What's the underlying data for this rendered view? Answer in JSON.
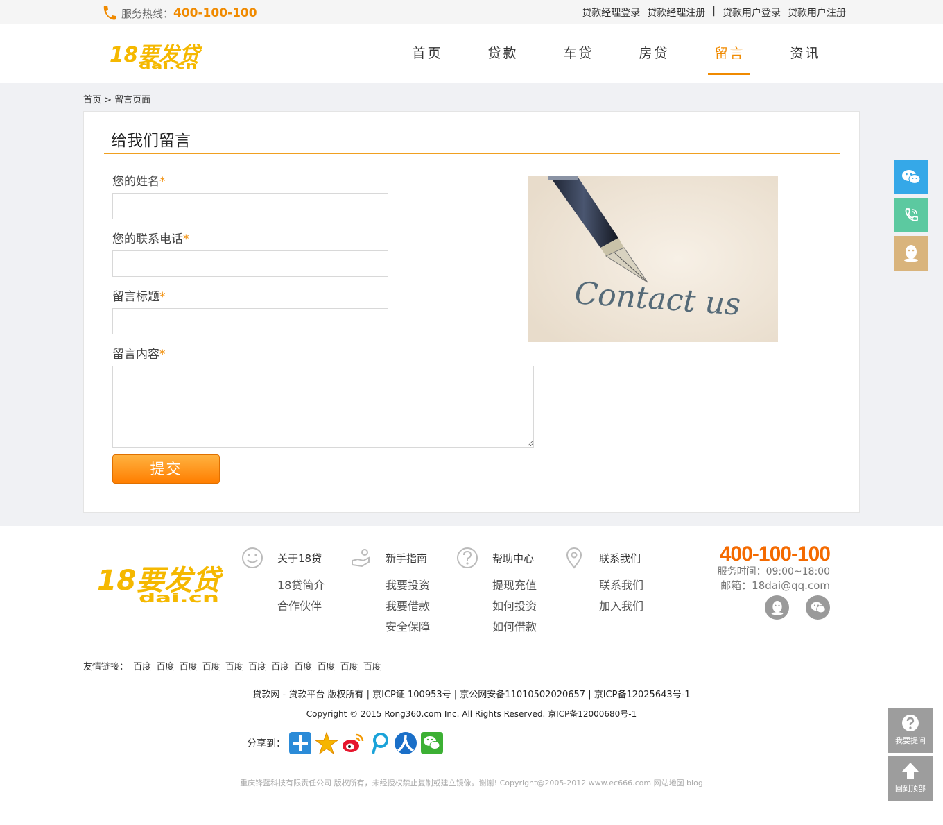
{
  "topbar": {
    "hotline_label": "服务热线：",
    "hotline_number": "400-100-100",
    "links": [
      "贷款经理登录",
      "贷款经理注册",
      "|",
      "贷款用户登录",
      "贷款用户注册"
    ]
  },
  "header": {
    "logo_top": "18要发贷",
    "logo_bottom": "dai.cn",
    "nav": [
      "首页",
      "贷款",
      "车贷",
      "房贷",
      "留言",
      "资讯"
    ],
    "active_nav": "留言"
  },
  "breadcrumb": "首页 > 留言页面",
  "form": {
    "title": "给我们留言",
    "name_label": "您的姓名",
    "phone_label": "您的联系电话",
    "subject_label": "留言标题",
    "content_label": "留言内容",
    "required_mark": "*",
    "name_value": "",
    "phone_value": "",
    "subject_value": "",
    "content_value": "",
    "submit_label": "提交"
  },
  "contact_image": {
    "text": "Contact us"
  },
  "footer": {
    "logo_top": "18要发贷",
    "logo_bottom": "dai.cn",
    "columns": [
      {
        "head": "关于18贷",
        "items": [
          "18贷简介",
          "合作伙伴"
        ]
      },
      {
        "head": "新手指南",
        "items": [
          "我要投资",
          "我要借款",
          "安全保障"
        ]
      },
      {
        "head": "帮助中心",
        "items": [
          "提现充值",
          "如何投资",
          "如何借款"
        ]
      },
      {
        "head": "联系我们",
        "items": [
          "联系我们",
          "加入我们"
        ]
      }
    ],
    "phone": "400-100-100",
    "hours": "服务时间：09:00~18:00",
    "email": "邮箱：18dai@qq.com",
    "links_label": "友情链接：",
    "links": [
      "百度",
      "百度",
      "百度",
      "百度",
      "百度",
      "百度",
      "百度",
      "百度",
      "百度",
      "百度",
      "百度"
    ],
    "copy1": "贷款网 - 贷款平台 版权所有 | 京ICP证 100953号 | 京公网安备11010502020657 | 京ICP备12025643号-1",
    "copy2": "Copyright © 2015 Rong360.com Inc. All Rights Reserved. 京ICP备12000680号-1",
    "share_label": "分享到：",
    "copy3": "重庆锋蓝科技有限责任公司 版权所有，未经授权禁止复制或建立镜像。谢谢! Copyright@2005-2012 www.ec666.com 网站地图 blog"
  },
  "floating": {
    "ask_label": "我要提问",
    "top_label": "回到顶部"
  },
  "colors": {
    "accent": "#f08a00",
    "wechat": "#35a8e8",
    "phone": "#5cc9a0",
    "qq": "#d9b47c"
  }
}
